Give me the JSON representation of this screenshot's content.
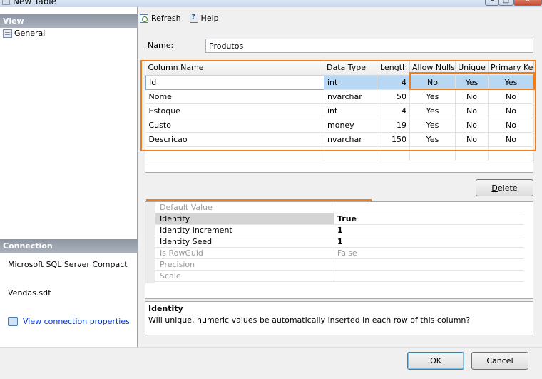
{
  "window": {
    "title": "New Table",
    "minimize": "–",
    "maximize": "□",
    "close": "✕"
  },
  "left_panel": {
    "view_header": "View",
    "nav_items": [
      {
        "label": "General",
        "icon": "general-page-icon"
      }
    ],
    "connection_header": "Connection",
    "server": "Microsoft SQL Server Compact",
    "database": "Vendas.sdf",
    "connection_link": "View connection properties"
  },
  "toolbar": {
    "refresh_label": "Refresh",
    "help_label": "Help"
  },
  "name_field": {
    "label_prefix": "",
    "label_mnemonic": "N",
    "label_rest": "ame:",
    "value": "Produtos"
  },
  "grid": {
    "headers": [
      "Column Name",
      "Data Type",
      "Length",
      "Allow Nulls",
      "Unique",
      "Primary Key"
    ],
    "rows": [
      [
        "Id",
        "int",
        "4",
        "No",
        "Yes",
        "Yes"
      ],
      [
        "Nome",
        "nvarchar",
        "50",
        "Yes",
        "No",
        "No"
      ],
      [
        "Estoque",
        "int",
        "4",
        "Yes",
        "No",
        "No"
      ],
      [
        "Custo",
        "money",
        "19",
        "Yes",
        "No",
        "No"
      ],
      [
        "Descricao",
        "nvarchar",
        "150",
        "Yes",
        "No",
        "No"
      ]
    ],
    "selected_row": 0
  },
  "delete_button": {
    "mnemonic": "D",
    "rest": "elete"
  },
  "properties": [
    {
      "key": "Default Value",
      "value": "",
      "enabled": false
    },
    {
      "key": "Identity",
      "value": "True",
      "enabled": true,
      "selected": true
    },
    {
      "key": "Identity Increment",
      "value": "1",
      "enabled": true
    },
    {
      "key": "Identity Seed",
      "value": "1",
      "enabled": true
    },
    {
      "key": "Is RowGuid",
      "value": "False",
      "enabled": false
    },
    {
      "key": "Precision",
      "value": "",
      "enabled": false
    },
    {
      "key": "Scale",
      "value": "",
      "enabled": false
    }
  ],
  "description": {
    "title": "Identity",
    "text": "Will unique, numeric values be automatically inserted in each row of this column?"
  },
  "buttons": {
    "ok": "OK",
    "cancel": "Cancel"
  },
  "colors": {
    "highlight": "#f07d1c",
    "selection": "#b8d7f3",
    "link": "#0033cc"
  }
}
